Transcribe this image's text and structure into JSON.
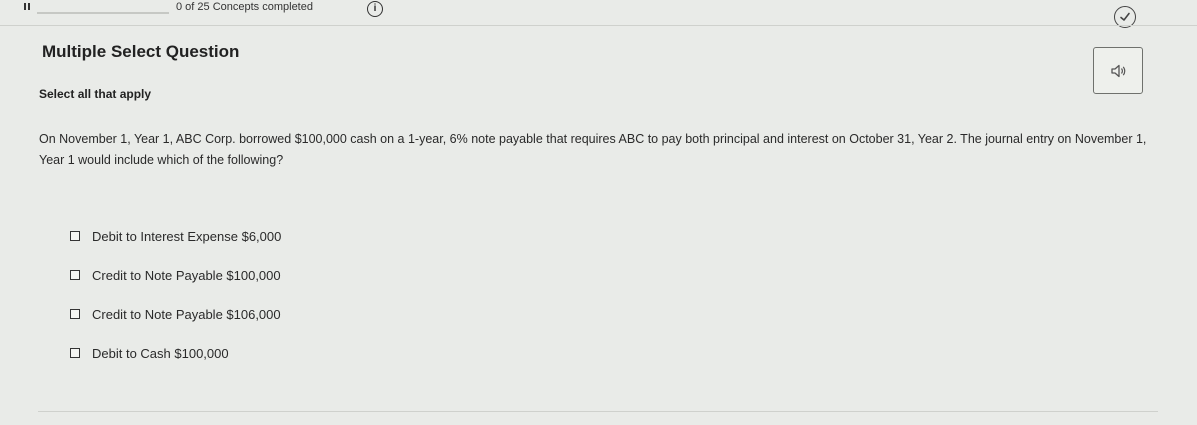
{
  "header": {
    "progress_text": "0 of 25 Concepts completed",
    "progress_fraction": 0
  },
  "question": {
    "type_label": "Multiple Select Question",
    "instruction": "Select all that apply",
    "prompt": "On November 1, Year 1, ABC Corp. borrowed $100,000 cash on a 1-year, 6% note payable that requires ABC to pay both principal and interest on October 31, Year 2. The journal entry on November 1, Year 1 would include which of the following?",
    "options": [
      {
        "label": "Debit to Interest Expense $6,000",
        "checked": false
      },
      {
        "label": "Credit to Note Payable $100,000",
        "checked": false
      },
      {
        "label": "Credit to Note Payable $106,000",
        "checked": false
      },
      {
        "label": "Debit to Cash $100,000",
        "checked": false
      }
    ]
  },
  "icons": {
    "pause": "pause-icon",
    "info": "info-icon",
    "info_glyph": "i",
    "check": "check-circle-icon",
    "audio": "speaker-icon"
  }
}
